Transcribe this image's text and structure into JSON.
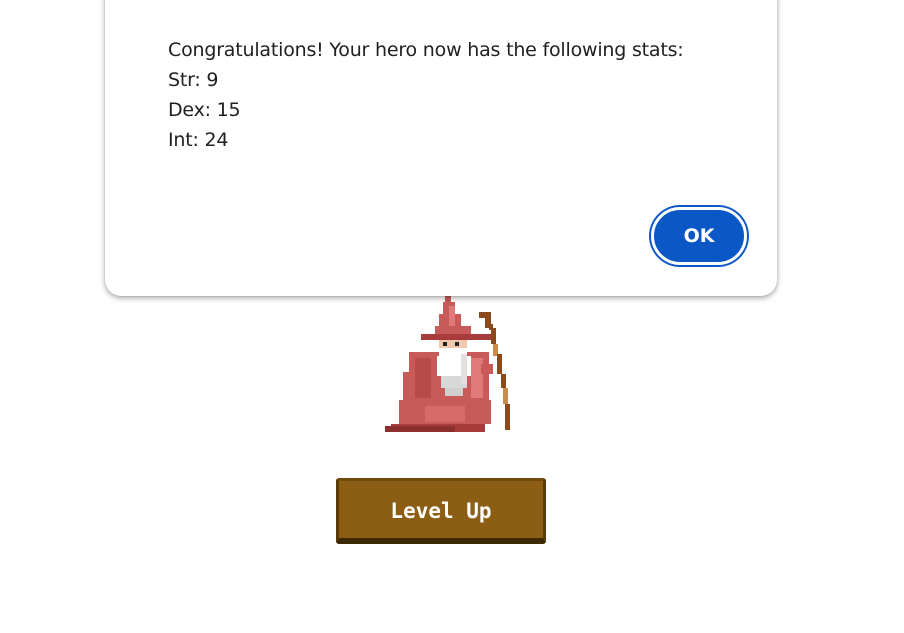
{
  "dialog": {
    "message_lines": [
      "Congratulations! Your hero now has the following stats:",
      "Str: 9",
      "Dex: 15",
      "Int: 24"
    ],
    "ok_label": "OK"
  },
  "hero": {
    "sprite_icon": "wizard-sprite-icon"
  },
  "actions": {
    "level_up_label": "Level Up"
  },
  "colors": {
    "dialog_button": "#0b57c6",
    "level_up_button": "#8b5e13",
    "wizard_robe": "#c85a5a"
  }
}
